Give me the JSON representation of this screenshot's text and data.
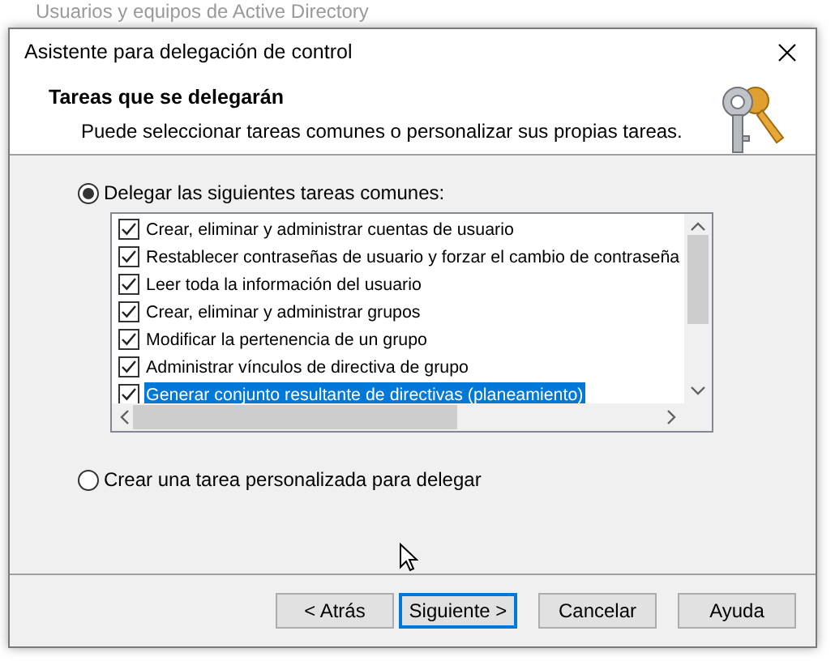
{
  "background_window": {
    "title": "Usuarios y equipos de Active Directory"
  },
  "window": {
    "title": "Asistente para delegación de control"
  },
  "header": {
    "title": "Tareas que se delegarán",
    "subtitle": "Puede seleccionar tareas comunes o personalizar sus propias tareas."
  },
  "options": [
    {
      "label": "Delegar las siguientes tareas comunes:",
      "selected": true,
      "kind": "list"
    },
    {
      "label": "Crear una tarea personalizada para delegar",
      "selected": false,
      "kind": "plain"
    }
  ],
  "tasks": [
    {
      "label": "Crear, eliminar y administrar cuentas de usuario",
      "checked": true,
      "selected": false
    },
    {
      "label": "Restablecer contraseñas de usuario y forzar el cambio de contraseña",
      "checked": true,
      "selected": false
    },
    {
      "label": "Leer toda la información del usuario",
      "checked": true,
      "selected": false
    },
    {
      "label": "Crear, eliminar y administrar grupos",
      "checked": true,
      "selected": false
    },
    {
      "label": "Modificar la pertenencia de un grupo",
      "checked": true,
      "selected": false
    },
    {
      "label": "Administrar vínculos de directiva de grupo",
      "checked": true,
      "selected": false
    },
    {
      "label": "Generar conjunto resultante de directivas (planeamiento)",
      "checked": true,
      "selected": true
    }
  ],
  "buttons": [
    {
      "label": "< Atrás",
      "default": false
    },
    {
      "label": "Siguiente >",
      "default": true
    },
    {
      "label": "Cancelar",
      "default": false
    },
    {
      "label": "Ayuda",
      "default": false
    }
  ]
}
